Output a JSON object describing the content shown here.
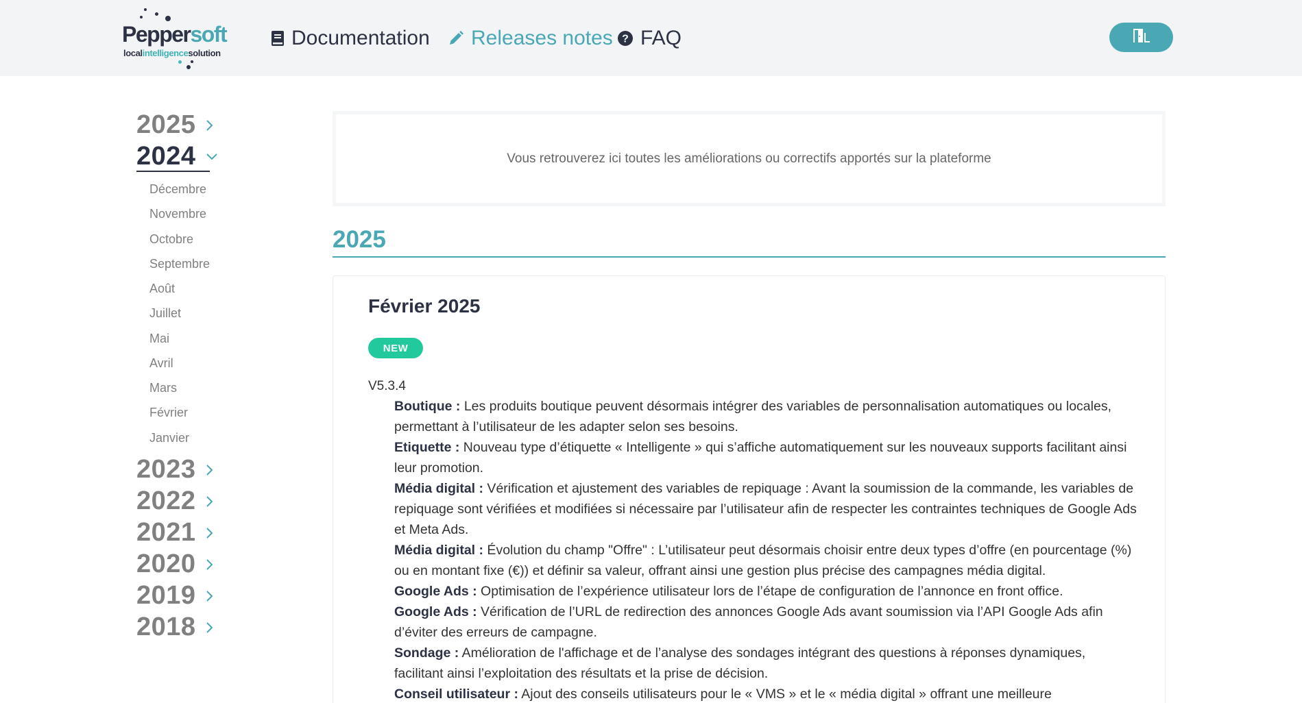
{
  "header": {
    "logo": {
      "name": "Peppersoft",
      "name_main": "Pepper",
      "name_accent": "soft",
      "tagline_start": "local",
      "tagline_mid": "intelligence",
      "tagline_end": "solution"
    },
    "nav": [
      {
        "label": "Documentation",
        "icon": "book-icon",
        "active": false
      },
      {
        "label": "Releases notes",
        "icon": "pencil-icon",
        "active": true
      },
      {
        "label": "FAQ",
        "icon": "question-circle-icon",
        "active": false
      }
    ],
    "logout_icon": "door-exit-icon",
    "accent_color": "#4aa8b4"
  },
  "sidebar": {
    "years": [
      {
        "label": "2025",
        "expanded": false
      },
      {
        "label": "2024",
        "expanded": true
      },
      {
        "label": "2023",
        "expanded": false
      },
      {
        "label": "2022",
        "expanded": false
      },
      {
        "label": "2021",
        "expanded": false
      },
      {
        "label": "2020",
        "expanded": false
      },
      {
        "label": "2019",
        "expanded": false
      },
      {
        "label": "2018",
        "expanded": false
      }
    ],
    "months": [
      "Décembre",
      "Novembre",
      "Octobre",
      "Septembre",
      "Août",
      "Juillet",
      "Mai",
      "Avril",
      "Mars",
      "Février",
      "Janvier"
    ]
  },
  "main": {
    "intro": "Vous retrouverez ici toutes les améliorations ou correctifs apportés sur la plateforme",
    "section_year": "2025",
    "release": {
      "title": "Février 2025",
      "badge": "NEW",
      "badge_color": "#22c99d",
      "version": "V5.3.4",
      "entries": [
        {
          "label": "Boutique :",
          "text": " Les produits boutique peuvent désormais intégrer des variables de personnalisation automatiques ou locales, permettant à l’utilisateur de les adapter selon ses besoins."
        },
        {
          "label": "Etiquette :",
          "text": " Nouveau type d’étiquette « Intelligente » qui s’affiche automatiquement sur les nouveaux supports facilitant ainsi leur promotion."
        },
        {
          "label": "Média digital :",
          "text": " Vérification et ajustement des variables de repiquage : Avant la soumission de la commande, les variables de repiquage sont vérifiées et modifiées si nécessaire par l’utilisateur afin de respecter les contraintes techniques de Google Ads et Meta Ads."
        },
        {
          "label": "Média digital :",
          "text": " Évolution du champ \"Offre\" : L’utilisateur peut désormais choisir entre deux types d’offre (en pourcentage (%) ou en montant fixe (€)) et définir sa valeur, offrant ainsi une gestion plus précise des campagnes média digital."
        },
        {
          "label": "Google Ads :",
          "text": " Optimisation de l’expérience utilisateur lors de l’étape de configuration de l’annonce en front office."
        },
        {
          "label": "Google Ads :",
          "text": " Vérification de l’URL de redirection des annonces Google Ads avant soumission via l’API Google Ads afin d’éviter des erreurs de campagne."
        },
        {
          "label": "Sondage :",
          "text": " Amélioration de l'affichage et de l’analyse des sondages intégrant des questions à réponses dynamiques, facilitant ainsi l’exploitation des résultats et la prise de décision."
        },
        {
          "label": "Conseil utilisateur :",
          "text": " Ajout des conseils utilisateurs pour le « VMS » et le « média digital » offrant une meilleure"
        }
      ]
    }
  }
}
